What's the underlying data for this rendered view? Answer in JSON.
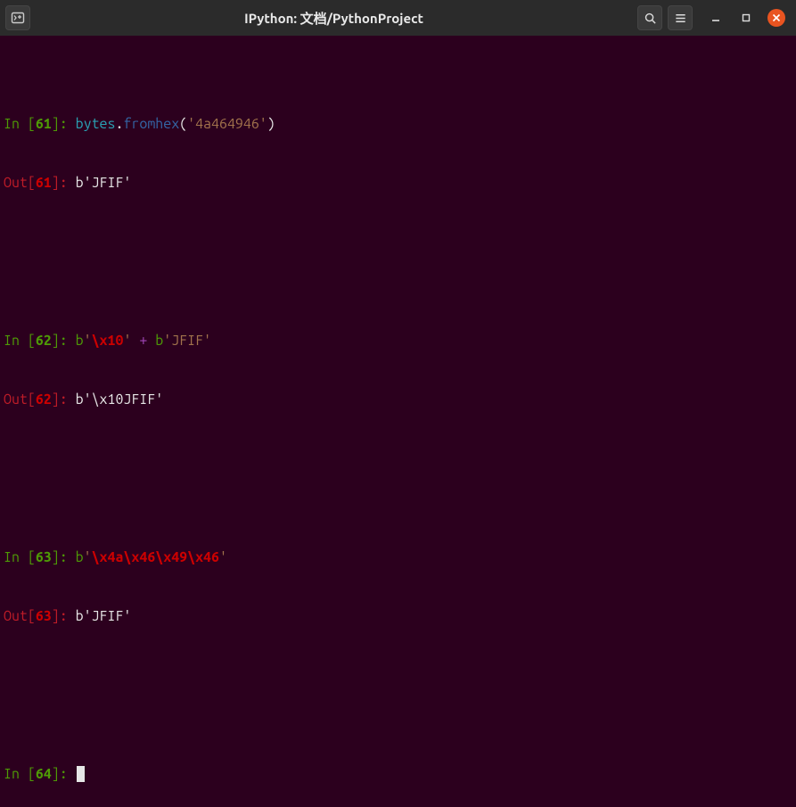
{
  "window": {
    "title": "IPython: 文档/PythonProject"
  },
  "titlebar_icons": {
    "newtab": "new-terminal-tab",
    "search": "search",
    "menu": "hamburger-menu",
    "minimize": "minimize",
    "maximize": "maximize",
    "close": "close"
  },
  "cells": [
    {
      "in_num": "61",
      "in_prefix": "In [",
      "in_suffix": "]: ",
      "out_prefix": "Out[",
      "out_suffix": "]: ",
      "code": {
        "obj": "bytes",
        "method": "fromhex",
        "arg": "'4a464946'"
      },
      "out_num": "61",
      "result": "b'JFIF'"
    },
    {
      "in_num": "62",
      "in_prefix": "In [",
      "in_suffix": "]: ",
      "out_prefix": "Out[",
      "out_suffix": "]: ",
      "code": {
        "b1_prefix": "b",
        "b1_quote_open": "'",
        "b1_escape": "\\x10",
        "b1_quote_close": "'",
        "op": " + ",
        "b2_prefix": "b",
        "b2": "'JFIF'"
      },
      "out_num": "62",
      "result": "b'\\x10JFIF'"
    },
    {
      "in_num": "63",
      "in_prefix": "In [",
      "in_suffix": "]: ",
      "out_prefix": "Out[",
      "out_suffix": "]: ",
      "code": {
        "b_prefix": "b",
        "quote_open": "'",
        "escapes": "\\x4a\\x46\\x49\\x46",
        "quote_close": "'"
      },
      "out_num": "63",
      "result": "b'JFIF'"
    }
  ],
  "prompt": {
    "in_prefix": "In [",
    "in_num": "64",
    "in_suffix": "]: "
  }
}
